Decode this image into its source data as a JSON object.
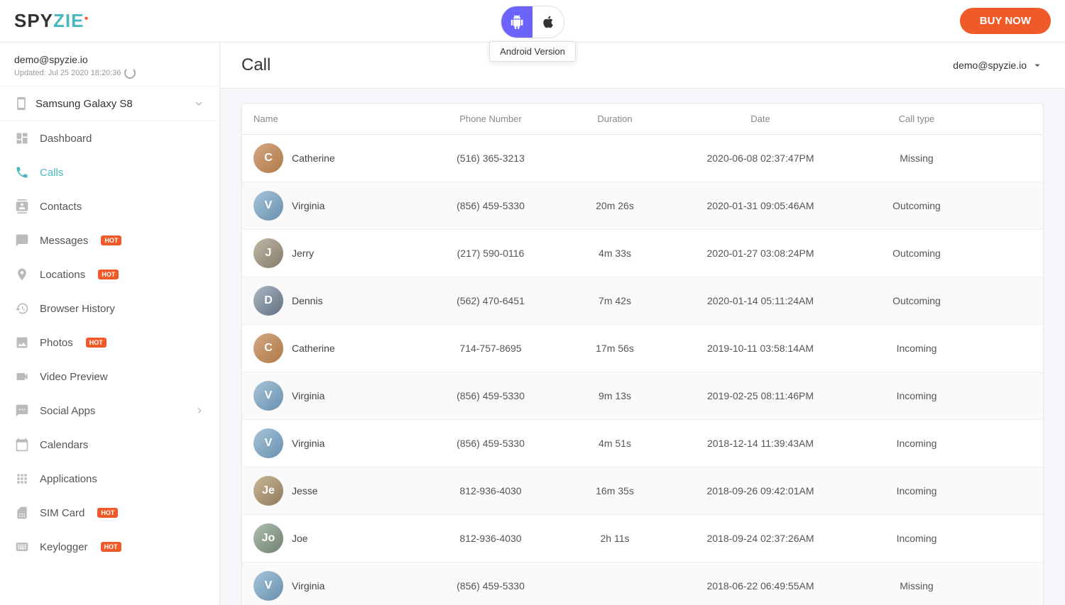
{
  "app": {
    "logo_spy": "SPY",
    "logo_zie": "ZIE",
    "buy_now_label": "BUY NOW"
  },
  "platform": {
    "android_label": "Android Version",
    "tooltip": "Android Version"
  },
  "header": {
    "title": "Call",
    "user_email": "demo@spyzie.io"
  },
  "account": {
    "email": "demo@spyzie.io",
    "updated": "Updated: Jul 25 2020 18:20:36"
  },
  "device": {
    "name": "Samsung Galaxy S8"
  },
  "sidebar": {
    "items": [
      {
        "id": "dashboard",
        "label": "Dashboard",
        "hot": false,
        "arrow": false
      },
      {
        "id": "calls",
        "label": "Calls",
        "hot": false,
        "arrow": false,
        "active": true
      },
      {
        "id": "contacts",
        "label": "Contacts",
        "hot": false,
        "arrow": false
      },
      {
        "id": "messages",
        "label": "Messages",
        "hot": true,
        "arrow": false
      },
      {
        "id": "locations",
        "label": "Locations",
        "hot": true,
        "arrow": false
      },
      {
        "id": "browser-history",
        "label": "Browser History",
        "hot": false,
        "arrow": false
      },
      {
        "id": "photos",
        "label": "Photos",
        "hot": true,
        "arrow": false
      },
      {
        "id": "video-preview",
        "label": "Video Preview",
        "hot": false,
        "arrow": false
      },
      {
        "id": "social-apps",
        "label": "Social Apps",
        "hot": false,
        "arrow": true
      },
      {
        "id": "calendars",
        "label": "Calendars",
        "hot": false,
        "arrow": false
      },
      {
        "id": "applications",
        "label": "Applications",
        "hot": false,
        "arrow": false
      },
      {
        "id": "sim-card",
        "label": "SIM Card",
        "hot": true,
        "arrow": false
      },
      {
        "id": "keylogger",
        "label": "Keylogger",
        "hot": true,
        "arrow": false
      }
    ]
  },
  "table": {
    "headers": [
      "Name",
      "Phone Number",
      "Duration",
      "Date",
      "Call type"
    ],
    "rows": [
      {
        "name": "Catherine",
        "phone": "(516) 365-3213",
        "duration": "",
        "date": "2020-06-08 02:37:47PM",
        "type": "Missing",
        "avatar_type": "female-1"
      },
      {
        "name": "Virginia",
        "phone": "(856) 459-5330",
        "duration": "20m 26s",
        "date": "2020-01-31 09:05:46AM",
        "type": "Outcoming",
        "avatar_type": "female-2"
      },
      {
        "name": "Jerry",
        "phone": "(217) 590-0116",
        "duration": "4m 33s",
        "date": "2020-01-27 03:08:24PM",
        "type": "Outcoming",
        "avatar_type": "male-1"
      },
      {
        "name": "Dennis",
        "phone": "(562) 470-6451",
        "duration": "7m 42s",
        "date": "2020-01-14 05:11:24AM",
        "type": "Outcoming",
        "avatar_type": "male-2"
      },
      {
        "name": "Catherine",
        "phone": "714-757-8695",
        "duration": "17m 56s",
        "date": "2019-10-11 03:58:14AM",
        "type": "Incoming",
        "avatar_type": "female-1"
      },
      {
        "name": "Virginia",
        "phone": "(856) 459-5330",
        "duration": "9m 13s",
        "date": "2019-02-25 08:11:46PM",
        "type": "Incoming",
        "avatar_type": "female-2"
      },
      {
        "name": "Virginia",
        "phone": "(856) 459-5330",
        "duration": "4m 51s",
        "date": "2018-12-14 11:39:43AM",
        "type": "Incoming",
        "avatar_type": "female-2"
      },
      {
        "name": "Jesse",
        "phone": "812-936-4030",
        "duration": "16m 35s",
        "date": "2018-09-26 09:42:01AM",
        "type": "Incoming",
        "avatar_type": "male-3"
      },
      {
        "name": "Joe",
        "phone": "812-936-4030",
        "duration": "2h 11s",
        "date": "2018-09-24 02:37:26AM",
        "type": "Incoming",
        "avatar_type": "male-4"
      },
      {
        "name": "Virginia",
        "phone": "(856) 459-5330",
        "duration": "",
        "date": "2018-06-22 06:49:55AM",
        "type": "Missing",
        "avatar_type": "female-2"
      }
    ]
  }
}
